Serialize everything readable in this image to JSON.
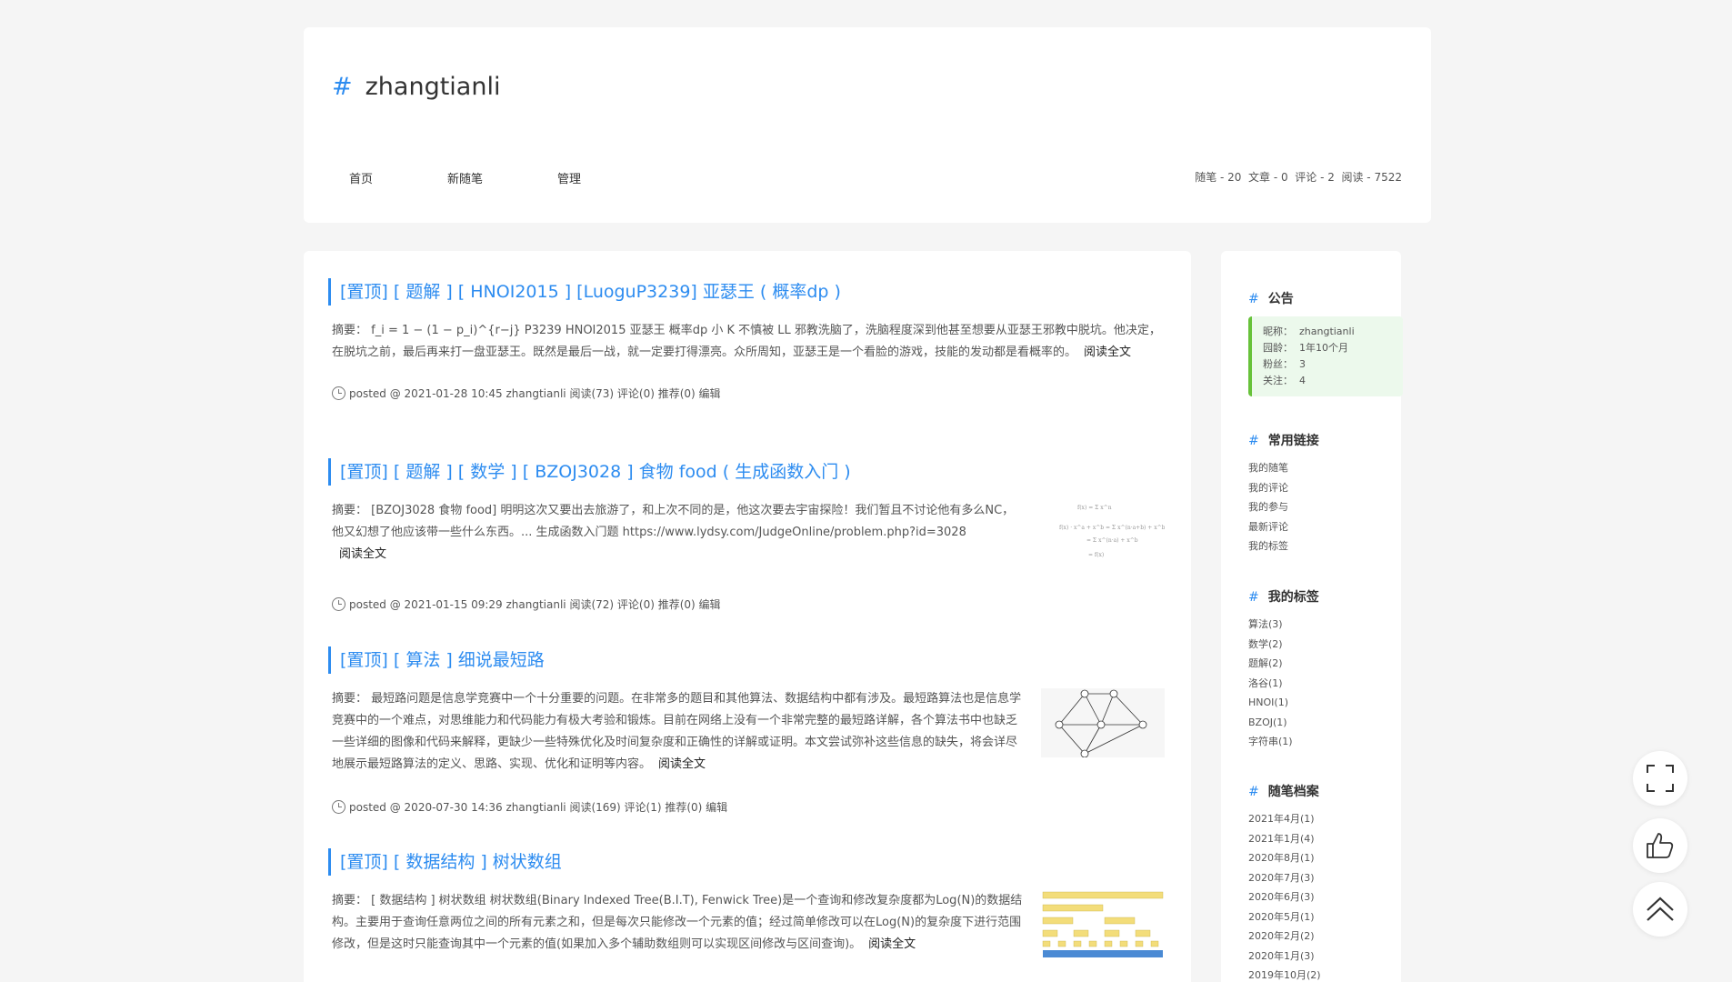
{
  "header": {
    "hash": "#",
    "blog_title": "zhangtianli",
    "nav": [
      "首页",
      "新随笔",
      "管理"
    ],
    "stats": "随笔 - 20  文章 - 0  评论 - 2  阅读 - 7522"
  },
  "posts": [
    {
      "title": "[置顶] [ 题解 ] [ HNOI2015 ] [LuoguP3239] 亚瑟王 ( 概率dp )",
      "summary": "摘要：  f_i = 1 − (1 − p_i)^{r−j}  P3239 HNOI2015 亚瑟王 概率dp 小 K 不慎被 LL 邪教洗脑了，洗脑程度深到他甚至想要从亚瑟王邪教中脱坑。他决定，在脱坑之前，最后再来打一盘亚瑟王。既然是最后一战，就一定要打得漂亮。众所周知，亚瑟王是一个看脸的游戏，技能的发动都是看概率的。",
      "more": "阅读全文",
      "meta": "posted @ 2021-01-28 10:45 zhangtianli 阅读(73) 评论(0) 推荐(0) 编辑"
    },
    {
      "title": "[置顶] [ 题解 ] [ 数学 ] [ BZOJ3028 ] 食物 food ( 生成函数入门 )",
      "summary": "摘要：  [BZOJ3028 食物 food] 明明这次又要出去旅游了，和上次不同的是，他这次要去宇宙探险！我们暂且不讨论他有多么NC，他又幻想了他应该带一些什么东西。... 生成函数入门题 https://www.lydsy.com/JudgeOnline/problem.php?id=3028",
      "more": "阅读全文",
      "meta": "posted @ 2021-01-15 09:29 zhangtianli 阅读(72) 评论(0) 推荐(0) 编辑"
    },
    {
      "title": "[置顶] [ 算法 ] 细说最短路",
      "summary": "摘要：  最短路问题是信息学竞赛中一个十分重要的问题。在非常多的题目和其他算法、数据结构中都有涉及。最短路算法也是信息学竞赛中的一个难点，对思维能力和代码能力有极大考验和锻炼。目前在网络上没有一个非常完整的最短路详解，各个算法书中也缺乏一些详细的图像和代码来解释，更缺少一些特殊优化及时间复杂度和正确性的详解或证明。本文尝试弥补这些信息的缺失，将会详尽地展示最短路算法的定义、思路、实现、优化和证明等内容。",
      "more": "阅读全文",
      "meta": "posted @ 2020-07-30 14:36 zhangtianli 阅读(169) 评论(1) 推荐(0) 编辑"
    },
    {
      "title": "[置顶] [ 数据结构 ] 树状数组",
      "summary": "摘要：  [ 数据结构 ] 树状数组 树状数组(Binary Indexed Tree(B.I.T), Fenwick Tree)是一个查询和修改复杂度都为Log(N)的数据结构。主要用于查询任意两位之间的所有元素之和，但是每次只能修改一个元素的值；经过简单修改可以在Log(N)的复杂度下进行范围修改，但是这时只能查询其中一个元素的值(如果加入多个辅助数组则可以实现区间修改与区间查询)。",
      "more": "阅读全文"
    }
  ],
  "sidebar": {
    "notice": {
      "heading": "公告",
      "rows": [
        {
          "k": "昵称：",
          "v": "zhangtianli"
        },
        {
          "k": "园龄：",
          "v": "1年10个月"
        },
        {
          "k": "粉丝：",
          "v": "3"
        },
        {
          "k": "关注：",
          "v": "4"
        }
      ]
    },
    "links": {
      "heading": "常用链接",
      "items": [
        "我的随笔",
        "我的评论",
        "我的参与",
        "最新评论",
        "我的标签"
      ]
    },
    "tags": {
      "heading": "我的标签",
      "items": [
        "算法(3)",
        "数学(2)",
        "题解(2)",
        "洛谷(1)",
        "HNOI(1)",
        "BZOJ(1)",
        "字符串(1)"
      ]
    },
    "archive": {
      "heading": "随笔档案",
      "items": [
        "2021年4月(1)",
        "2021年1月(4)",
        "2020年8月(1)",
        "2020年7月(3)",
        "2020年6月(3)",
        "2020年5月(1)",
        "2020年2月(2)",
        "2020年1月(3)",
        "2019年10月(2)"
      ]
    }
  },
  "floating_buttons": [
    "fullscreen-icon",
    "thumbs-up-icon",
    "back-to-top-icon"
  ],
  "colors": {
    "accent": "#2d8cf0",
    "notice_border": "#67c23a",
    "notice_bg": "#ecf9ec"
  }
}
